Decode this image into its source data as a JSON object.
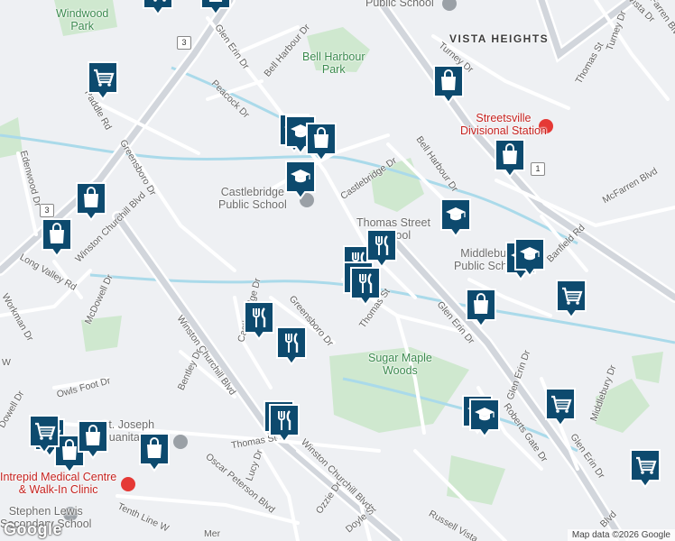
{
  "map": {
    "attribution": "Map data ©2026 Google",
    "logo": "Google",
    "area_label": "VISTA HEIGHTS",
    "parks": {
      "windwood": "Windwood\nPark",
      "bell_harbour": "Bell Harbour\nPark",
      "sugar_maple": "Sugar Maple\nWoods"
    },
    "pois": {
      "public_school_top": "Public School",
      "castlebridge": "Castlebridge\nPublic School",
      "thomas_street": "Thomas Street\nSchool",
      "middlebury": "Middlebury\nPublic School",
      "st_joseph": "St. Joseph\nJuanita P.",
      "stephen_lewis": "Stephen Lewis\nSecondary School"
    },
    "red_pois": {
      "streetsville_division": "Streetsville\nDivisional Station",
      "intrepid": "Intrepid Medical Centre\n& Walk-In Clinic"
    },
    "routes": {
      "r3a": "3",
      "r3b": "3",
      "r1": "1"
    },
    "streets": {
      "glen_erin_top": "Glen Erin Dr",
      "bell_harbour_dr": "Bell Harbour Dr",
      "peacock_dr": "Peacock Dr",
      "paddle_rd": "Paddle Rd",
      "greensboro_dr_w": "Greensboro Dr",
      "castlebridge_dr": "Castlebridge Dr",
      "bell_harbour_dr_e": "Bell Harbour Dr",
      "thomas_st_ne": "Thomas St",
      "turney_dr": "Turney Dr",
      "vista_dr": "Vista Dr",
      "mcfarren_top": "McFarren Blvd",
      "mcfarren_blvd": "McFarren Blvd",
      "banfield_rd": "Banfield Rd",
      "edenwood_dr": "Edenwood Dr",
      "winston_churchill_w": "Winston Churchill Blvd",
      "long_valley_rd": "Long Valley Rd",
      "mcdowell_dr": "McDowell Dr",
      "workman_dr": "Workman Dr",
      "castlebridge_dr_s": "Castlebridge Dr",
      "greensboro_dr_s": "Greensboro Dr",
      "thomas_st_center": "Thomas St",
      "glen_erin_dr_mid": "Glen Erin Dr",
      "winston_churchill_mid": "Winston Churchill Blvd",
      "owls_foot_dr": "Owls Foot Dr",
      "bentley_dr": "Bentley Dr",
      "thomas_st_sw": "Thomas St",
      "winston_churchill_s": "Winston Churchill Blvd",
      "lucy_dr": "Lucy Dr",
      "oscar_peterson_blvd": "Oscar Peterson Blvd",
      "ozzie_dr": "Ozzie Dr",
      "doyle_st": "Doyle St",
      "tenth_line": "Tenth Line W",
      "russell_vista": "Russell Vista",
      "glen_erin_dr_se": "Glen Erin Dr",
      "glen_erin_dr_s2": "Glen Erin Dr",
      "roberts_gate_dr": "Roberts Gate Dr",
      "middlebury_dr": "Middlebury Dr",
      "blvd_se": "Blvd",
      "dowell_w": "Dowell Dr",
      "w_edge": "W",
      "mer": "Mer"
    },
    "markers": [
      {
        "name": "grocery-marker",
        "icon": "shopping-cart-icon"
      },
      {
        "name": "shopping-bag-marker",
        "icon": "shopping-bag-icon"
      },
      {
        "name": "grocery-marker",
        "icon": "shopping-cart-icon"
      },
      {
        "name": "shopping-bag-marker",
        "icon": "shopping-bag-icon"
      },
      {
        "name": "school-marker",
        "icon": "graduation-cap-icon"
      },
      {
        "name": "school-marker",
        "icon": "graduation-cap-icon"
      },
      {
        "name": "shopping-bag-marker",
        "icon": "shopping-bag-icon"
      },
      {
        "name": "school-marker",
        "icon": "graduation-cap-icon"
      },
      {
        "name": "shopping-bag-marker",
        "icon": "shopping-bag-icon"
      },
      {
        "name": "shopping-bag-marker",
        "icon": "shopping-bag-icon"
      },
      {
        "name": "shopping-bag-marker",
        "icon": "shopping-bag-icon"
      },
      {
        "name": "school-marker",
        "icon": "graduation-cap-icon"
      },
      {
        "name": "restaurant-marker",
        "icon": "fork-knife-icon"
      },
      {
        "name": "restaurant-marker",
        "icon": "fork-knife-icon"
      },
      {
        "name": "restaurant-marker",
        "icon": "fork-knife-icon"
      },
      {
        "name": "restaurant-marker",
        "icon": "fork-knife-icon"
      },
      {
        "name": "school-marker",
        "icon": "graduation-cap-icon"
      },
      {
        "name": "school-marker",
        "icon": "graduation-cap-icon"
      },
      {
        "name": "grocery-marker",
        "icon": "shopping-cart-icon"
      },
      {
        "name": "restaurant-marker",
        "icon": "fork-knife-icon"
      },
      {
        "name": "restaurant-marker",
        "icon": "fork-knife-icon"
      },
      {
        "name": "shopping-bag-marker",
        "icon": "shopping-bag-icon"
      },
      {
        "name": "restaurant-marker",
        "icon": "fork-knife-icon"
      },
      {
        "name": "restaurant-marker",
        "icon": "fork-knife-icon"
      },
      {
        "name": "grocery-marker",
        "icon": "shopping-cart-icon"
      },
      {
        "name": "shopping-bag-marker",
        "icon": "shopping-bag-icon"
      },
      {
        "name": "shopping-bag-marker",
        "icon": "shopping-bag-icon"
      },
      {
        "name": "grocery-marker",
        "icon": "shopping-cart-icon"
      },
      {
        "name": "shopping-bag-marker",
        "icon": "shopping-bag-icon"
      },
      {
        "name": "school-marker",
        "icon": "graduation-cap-icon"
      },
      {
        "name": "school-marker",
        "icon": "graduation-cap-icon"
      },
      {
        "name": "grocery-marker",
        "icon": "shopping-cart-icon"
      },
      {
        "name": "grocery-marker",
        "icon": "shopping-cart-icon"
      }
    ],
    "colors": {
      "marker_fill": "#0d4a6e",
      "park": "#c8e6c9",
      "water": "#a9dcec",
      "road": "#ffffff",
      "highway": "#c9ced6"
    }
  }
}
